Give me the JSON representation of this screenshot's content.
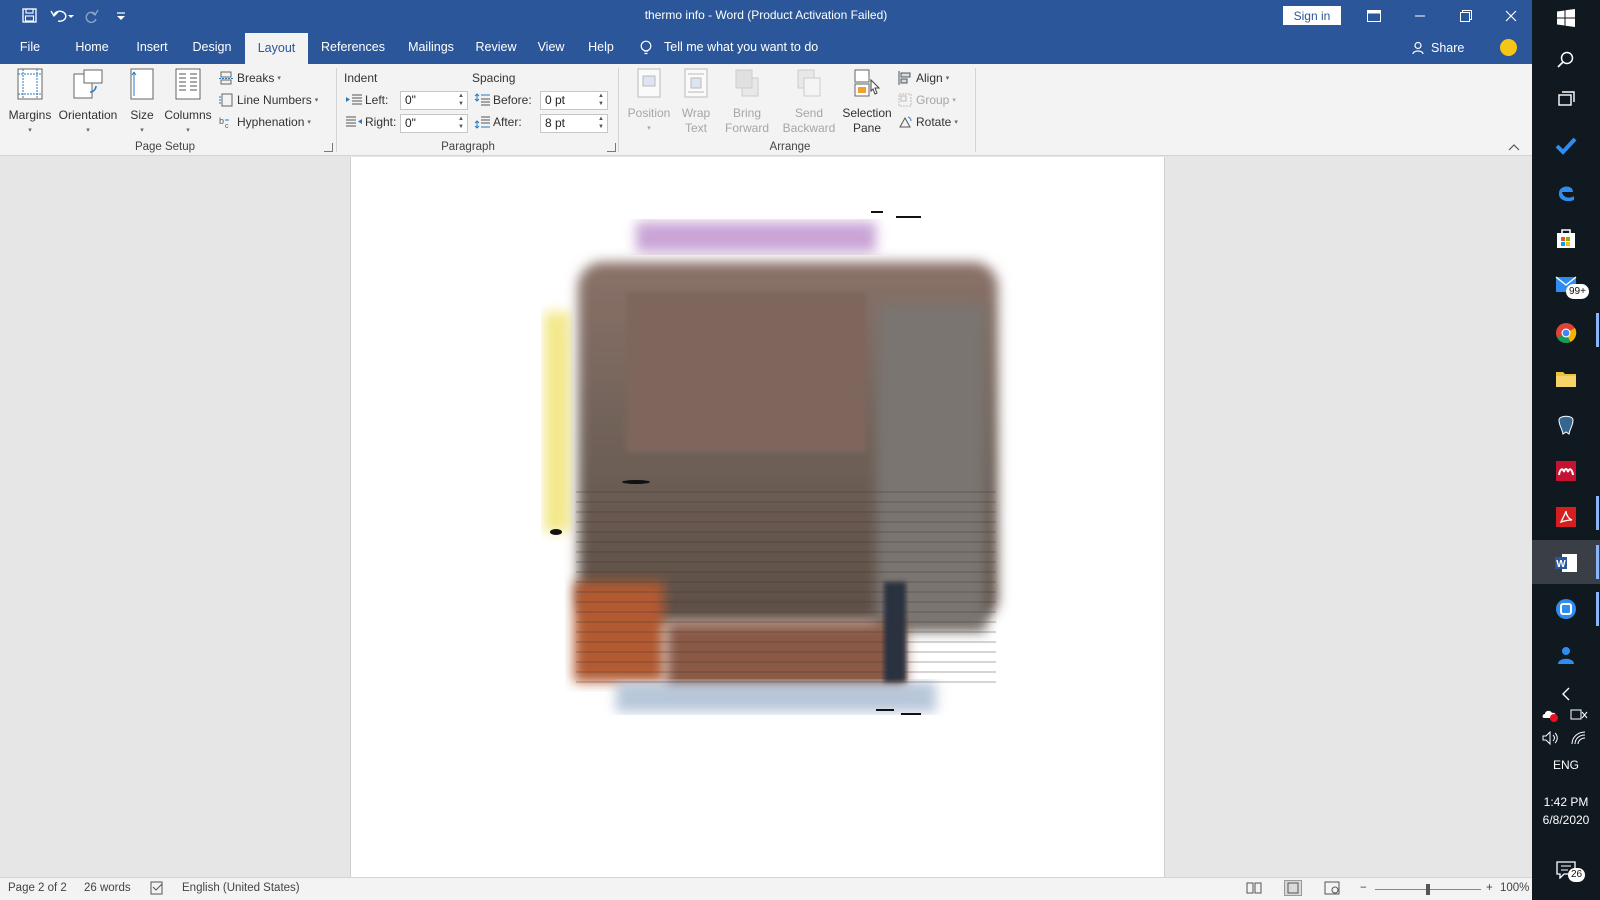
{
  "titlebar": {
    "title": "thermo info  -  Word (Product Activation Failed)",
    "sign_in": "Sign in"
  },
  "tabs": [
    {
      "label": "File"
    },
    {
      "label": "Home"
    },
    {
      "label": "Insert"
    },
    {
      "label": "Design"
    },
    {
      "label": "Layout",
      "active": true
    },
    {
      "label": "References"
    },
    {
      "label": "Mailings"
    },
    {
      "label": "Review"
    },
    {
      "label": "View"
    },
    {
      "label": "Help"
    }
  ],
  "tell_me": "Tell me what you want to do",
  "share": "Share",
  "ribbon": {
    "page_setup": {
      "margins": "Margins",
      "orientation": "Orientation",
      "size": "Size",
      "columns": "Columns",
      "breaks": "Breaks",
      "line_numbers": "Line Numbers",
      "hyphenation": "Hyphenation",
      "label": "Page Setup"
    },
    "paragraph": {
      "indent_heading": "Indent",
      "spacing_heading": "Spacing",
      "left_label": "Left:",
      "left_value": "0\"",
      "right_label": "Right:",
      "right_value": "0\"",
      "before_label": "Before:",
      "before_value": "0 pt",
      "after_label": "After:",
      "after_value": "8 pt",
      "label": "Paragraph"
    },
    "arrange": {
      "position": "Position",
      "wrap_text_1": "Wrap",
      "wrap_text_2": "Text",
      "bring_forward_1": "Bring",
      "bring_forward_2": "Forward",
      "send_backward_1": "Send",
      "send_backward_2": "Backward",
      "selection_pane_1": "Selection",
      "selection_pane_2": "Pane",
      "align": "Align",
      "group": "Group",
      "rotate": "Rotate",
      "label": "Arrange"
    }
  },
  "status": {
    "page": "Page 2 of 2",
    "words": "26 words",
    "language": "English (United States)",
    "zoom": "100%",
    "zoom_level": 1.0
  },
  "taskbar": {
    "mail_badge": "99+",
    "language": "ENG",
    "time": "1:42 PM",
    "date": "6/8/2020",
    "notifications": "26"
  },
  "colors": {
    "word_blue": "#2b579a",
    "ribbon_bg": "#f3f3f3",
    "canvas_bg": "#e6e6e6",
    "taskbar_bg": "#101820"
  }
}
